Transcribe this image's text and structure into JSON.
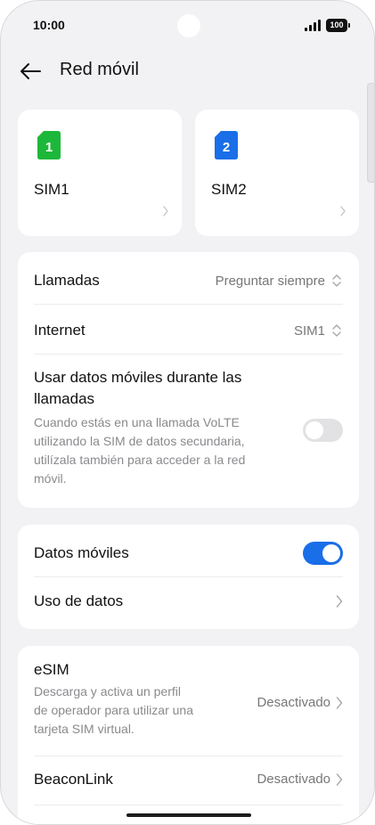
{
  "status_bar": {
    "time": "10:00",
    "battery": "100"
  },
  "header": {
    "title": "Red móvil"
  },
  "sim_cards": [
    {
      "number": "1",
      "label": "SIM1",
      "color": "#1db83a"
    },
    {
      "number": "2",
      "label": "SIM2",
      "color": "#1a6ee8"
    }
  ],
  "settings_card": {
    "calls": {
      "title": "Llamadas",
      "value": "Preguntar siempre"
    },
    "internet": {
      "title": "Internet",
      "value": "SIM1"
    },
    "data_during_calls": {
      "title_line1": "Usar datos móviles durante las",
      "title_line2": "llamadas",
      "desc_line1": "Cuando estás en una llamada VoLTE",
      "desc_line2": "utilizando la SIM de datos secundaria,",
      "desc_line3": "utilízala también para acceder a la red",
      "desc_line4": "móvil.",
      "enabled": false
    }
  },
  "data_card": {
    "mobile_data": {
      "title": "Datos móviles",
      "enabled": true
    },
    "data_usage": {
      "title": "Uso de datos"
    }
  },
  "esim_card": {
    "esim": {
      "title": "eSIM",
      "desc_line1": "Descarga y activa un perfil",
      "desc_line2": "de operador para utilizar una",
      "desc_line3": "tarjeta SIM virtual.",
      "value": "Desactivado"
    },
    "beaconlink": {
      "title": "BeaconLink",
      "value": "Desactivado"
    }
  },
  "colors": {
    "accent": "#1a6ee8",
    "sim1": "#1db83a",
    "background": "#f2f2f4"
  }
}
